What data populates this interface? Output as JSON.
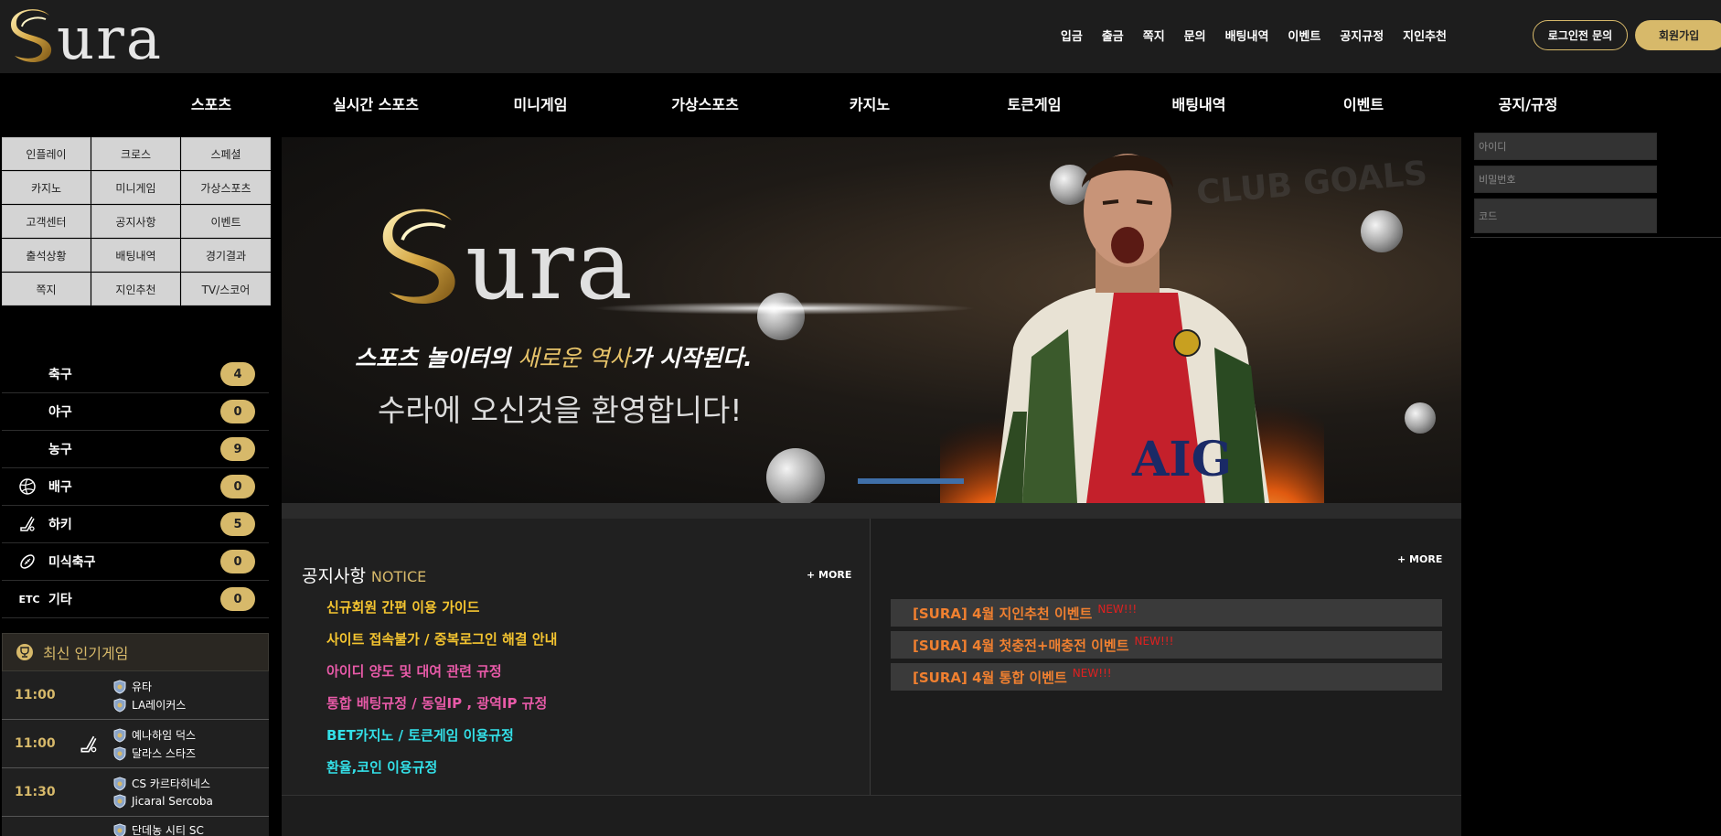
{
  "brand": {
    "logo_text": "ura",
    "gold": "#d7b96a"
  },
  "topnav": [
    "입금",
    "출금",
    "쪽지",
    "문의",
    "배팅내역",
    "이벤트",
    "공지규정",
    "지인추천"
  ],
  "header_buttons": {
    "login_inquiry": "로그인전 문의",
    "join": "회원가입"
  },
  "mainnav": [
    "스포츠",
    "실시간 스포츠",
    "미니게임",
    "가상스포츠",
    "카지노",
    "토큰게임",
    "배팅내역",
    "이벤트",
    "공지/규정"
  ],
  "quick_grid": [
    "인플레이",
    "크로스",
    "스페셜",
    "카지노",
    "미니게임",
    "가상스포츠",
    "고객센터",
    "공지사항",
    "이벤트",
    "출석상황",
    "배팅내역",
    "경기결과",
    "쪽지",
    "지인추천",
    "TV/스코어"
  ],
  "sports": [
    {
      "name": "축구",
      "count": "4",
      "icon": "soccer-icon"
    },
    {
      "name": "야구",
      "count": "0",
      "icon": "baseball-icon"
    },
    {
      "name": "농구",
      "count": "9",
      "icon": "basketball-icon"
    },
    {
      "name": "배구",
      "count": "0",
      "icon": "volleyball-icon"
    },
    {
      "name": "하키",
      "count": "5",
      "icon": "hockey-icon"
    },
    {
      "name": "미식축구",
      "count": "0",
      "icon": "football-icon"
    },
    {
      "name": "기타",
      "count": "0",
      "icon": "etc-icon",
      "icon_text": "ETC"
    }
  ],
  "popular": {
    "title": "최신 인기게임",
    "games": [
      {
        "time": "11:00",
        "home": "유타",
        "away": "LA레이커스",
        "sport_icon": ""
      },
      {
        "time": "11:00",
        "home": "예나하임 덕스",
        "away": "달라스 스타즈",
        "sport_icon": "hockey-icon"
      },
      {
        "time": "11:30",
        "home": "CS 카르타히네스",
        "away": "Jicaral Sercoba",
        "sport_icon": ""
      },
      {
        "time": "",
        "home": "단데농 시티 SC",
        "away": "",
        "sport_icon": ""
      }
    ]
  },
  "banner": {
    "logo_text": "ura",
    "subtitle_a": "스포츠 놀이터의 ",
    "subtitle_b": "새로운 역사",
    "subtitle_c": "가 시작된다.",
    "welcome": "수라에 오신것을 환영합니다!",
    "bg_text": "CLUB GOALS",
    "shirt_text": "AIG"
  },
  "login": {
    "id_placeholder": "아이디",
    "pw_placeholder": "비밀번호",
    "code_placeholder": "코드"
  },
  "notice": {
    "title": "공지사항",
    "subtitle": "NOTICE",
    "more": "+ MORE",
    "items": [
      {
        "text": "신규회원 간편 이용 가이드",
        "color": "#f4c430"
      },
      {
        "text": "사이트 접속불가 / 중복로그인 해결 안내",
        "color": "#f4c430"
      },
      {
        "text": "아이디 양도 및 대여 관련 규정",
        "color": "#e85aa8"
      },
      {
        "text": "통합 배팅규정 / 동일IP , 광역IP 규정",
        "color": "#e85aa8"
      },
      {
        "text": "BET카지노 / 토큰게임 이용규정",
        "color": "#33e0e8"
      },
      {
        "text": "환율,코인 이용규정",
        "color": "#33e0e8"
      }
    ]
  },
  "events": {
    "more": "+ MORE",
    "items": [
      {
        "text": "[SURA] 4월 지인추천 이벤트",
        "badge": "NEW!!!"
      },
      {
        "text": "[SURA] 4월 첫충전+매충전 이벤트",
        "badge": "NEW!!!"
      },
      {
        "text": "[SURA] 4월 통합 이벤트",
        "badge": "NEW!!!"
      }
    ]
  }
}
